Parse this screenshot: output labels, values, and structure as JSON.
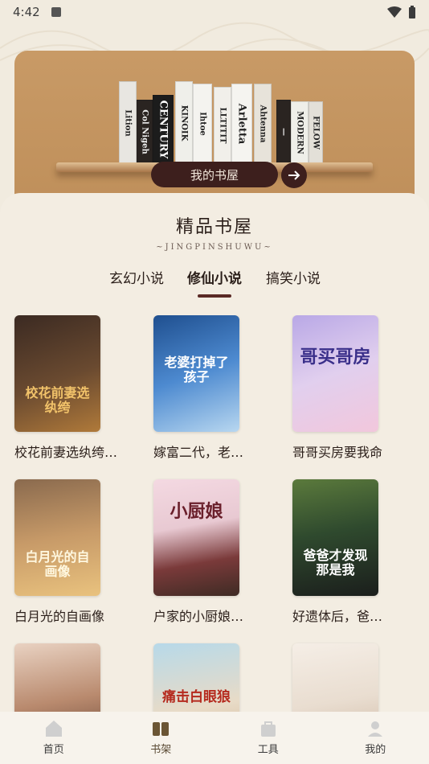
{
  "status": {
    "time": "4:42"
  },
  "banner": {
    "my_bookhouse_label": "我的书屋"
  },
  "section": {
    "title": "精品书屋",
    "subtitle": "~JINGPINSHUWU~"
  },
  "tabs": [
    {
      "label": "玄幻小说"
    },
    {
      "label": "修仙小说"
    },
    {
      "label": "搞笑小说"
    }
  ],
  "books": [
    {
      "title": "校花前妻选纨绔…",
      "cover_text": "校花前妻选纨绔"
    },
    {
      "title": "嫁富二代，老…",
      "cover_text": "老婆打掉了孩子"
    },
    {
      "title": "哥哥买房要我命",
      "cover_text": "哥买哥房"
    },
    {
      "title": "白月光的自画像",
      "cover_text": "白月光的自画像"
    },
    {
      "title": "户家的小厨娘…",
      "cover_text": "小厨娘"
    },
    {
      "title": "好遗体后，爸…",
      "cover_text": "爸爸才发现那是我"
    },
    {
      "title": "",
      "cover_text": ""
    },
    {
      "title": "",
      "cover_text": "痛击白眼狼"
    },
    {
      "title": "",
      "cover_text": ""
    }
  ],
  "bottom_nav": [
    {
      "label": "首页",
      "icon": "home-icon"
    },
    {
      "label": "书架",
      "icon": "bookshelf-icon"
    },
    {
      "label": "工具",
      "icon": "toolbox-icon"
    },
    {
      "label": "我的",
      "icon": "profile-icon"
    }
  ],
  "colors": {
    "accent": "#5a2a25",
    "background": "#f3ede2",
    "banner": "#c89a66"
  }
}
